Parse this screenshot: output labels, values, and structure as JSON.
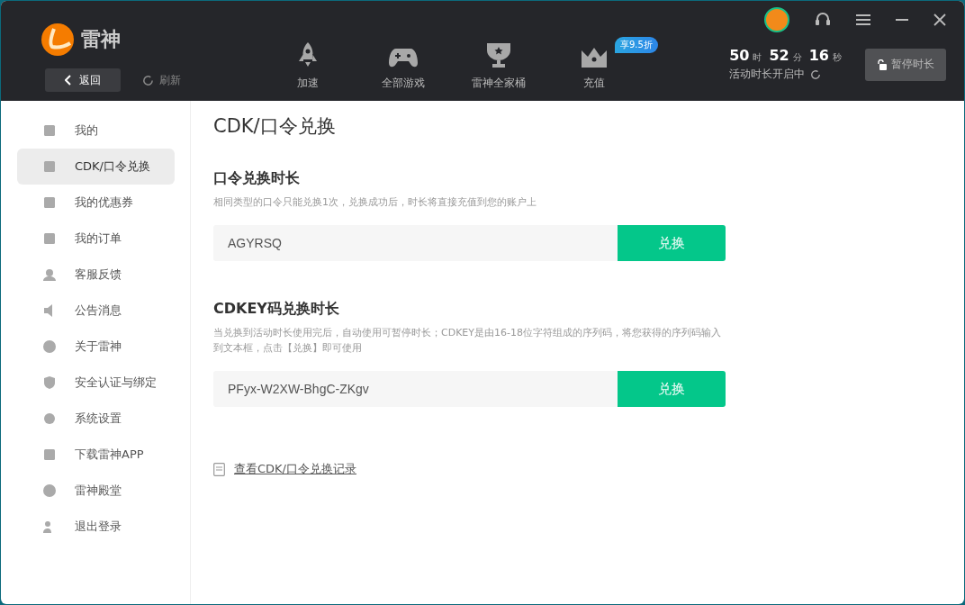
{
  "header": {
    "logo_text": "雷神",
    "back_button": "返回",
    "refresh_link": "刷新",
    "nav": [
      {
        "label": "加速"
      },
      {
        "label": "全部游戏"
      },
      {
        "label": "雷神全家桶"
      },
      {
        "label": "充值",
        "badge": "享9.5折"
      }
    ],
    "timer": [
      {
        "value": "50",
        "unit": "时"
      },
      {
        "value": "52",
        "unit": "分"
      },
      {
        "value": "16",
        "unit": "秒"
      }
    ],
    "timer_status": "活动时长开启中",
    "pause_button": "暂停时长"
  },
  "sidebar": {
    "items": [
      {
        "label": "我的",
        "selected": false
      },
      {
        "label": "CDK/口令兑换",
        "selected": true
      },
      {
        "label": "我的优惠券",
        "selected": false
      },
      {
        "label": "我的订单",
        "selected": false
      },
      {
        "label": "客服反馈",
        "selected": false
      },
      {
        "label": "公告消息",
        "selected": false
      },
      {
        "label": "关于雷神",
        "selected": false
      },
      {
        "label": "安全认证与绑定",
        "selected": false
      },
      {
        "label": "系统设置",
        "selected": false
      },
      {
        "label": "下载雷神APP",
        "selected": false
      },
      {
        "label": "雷神殿堂",
        "selected": false
      },
      {
        "label": "退出登录",
        "selected": false
      }
    ]
  },
  "page_title": "CDK/口令兑换",
  "sections": [
    {
      "title": "口令兑换时长",
      "description": "相同类型的口令只能兑换1次，兑换成功后，时长将直接充值到您的账户上",
      "value": "AGYRSQ",
      "button": "兑换"
    },
    {
      "title": "CDKEY码兑换时长",
      "description": "当兑换到活动时长使用完后，自动使用可暂停时长；CDKEY是由16-18位字符组成的序列码，将您获得的序列码输入到文本框，点击【兑换】即可使用",
      "value": "PFyx-W2XW-BhgC-ZKgv",
      "button": "兑换"
    }
  ],
  "history_link": "查看CDK/口令兑换记录"
}
